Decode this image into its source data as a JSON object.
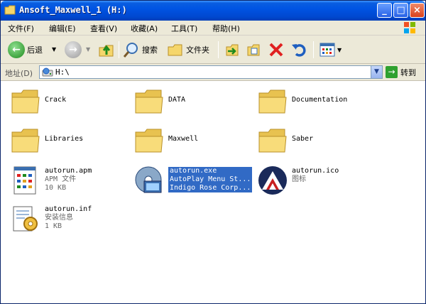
{
  "window": {
    "title": "Ansoft_Maxwell_1 (H:)",
    "minimize_label": "_",
    "maximize_label": "□",
    "close_label": "×"
  },
  "menu": [
    {
      "label": "文件(F)"
    },
    {
      "label": "编辑(E)"
    },
    {
      "label": "查看(V)"
    },
    {
      "label": "收藏(A)"
    },
    {
      "label": "工具(T)"
    },
    {
      "label": "帮助(H)"
    }
  ],
  "toolbar": {
    "back_label": "后退",
    "search_label": "搜索",
    "folders_label": "文件夹"
  },
  "address": {
    "label": "地址(D)",
    "value": "H:\\",
    "go_label": "转到"
  },
  "items": [
    {
      "name": "Crack",
      "type": "folder"
    },
    {
      "name": "DATA",
      "type": "folder"
    },
    {
      "name": "Documentation",
      "type": "folder"
    },
    {
      "name": "Libraries",
      "type": "folder"
    },
    {
      "name": "Maxwell",
      "type": "folder"
    },
    {
      "name": "Saber",
      "type": "folder"
    },
    {
      "name": "autorun.apm",
      "line2": "APM 文件",
      "line3": "10 KB",
      "type": "apm"
    },
    {
      "name": "autorun.exe",
      "line2": "AutoPlay Menu St...",
      "line3": "Indigo Rose Corp...",
      "type": "exe",
      "selected": true
    },
    {
      "name": "autorun.ico",
      "line2": "图标",
      "type": "ico"
    },
    {
      "name": "autorun.inf",
      "line2": "安装信息",
      "line3": "1 KB",
      "type": "inf"
    }
  ],
  "colors": {
    "titlebar": "#0054e3",
    "selection": "#316ac5",
    "chrome": "#ece9d8",
    "folder": "#f5d66b"
  }
}
